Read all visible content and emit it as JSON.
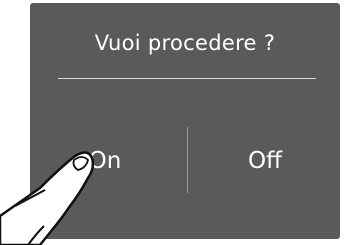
{
  "dialog": {
    "title": "Vuoi procedere ?",
    "on_label": "On",
    "off_label": "Off"
  },
  "colors": {
    "panel": "#5a5a5a",
    "text": "#ffffff",
    "divider": "#d9d9d9"
  },
  "icons": {
    "pointer": "finger-tap-icon"
  }
}
